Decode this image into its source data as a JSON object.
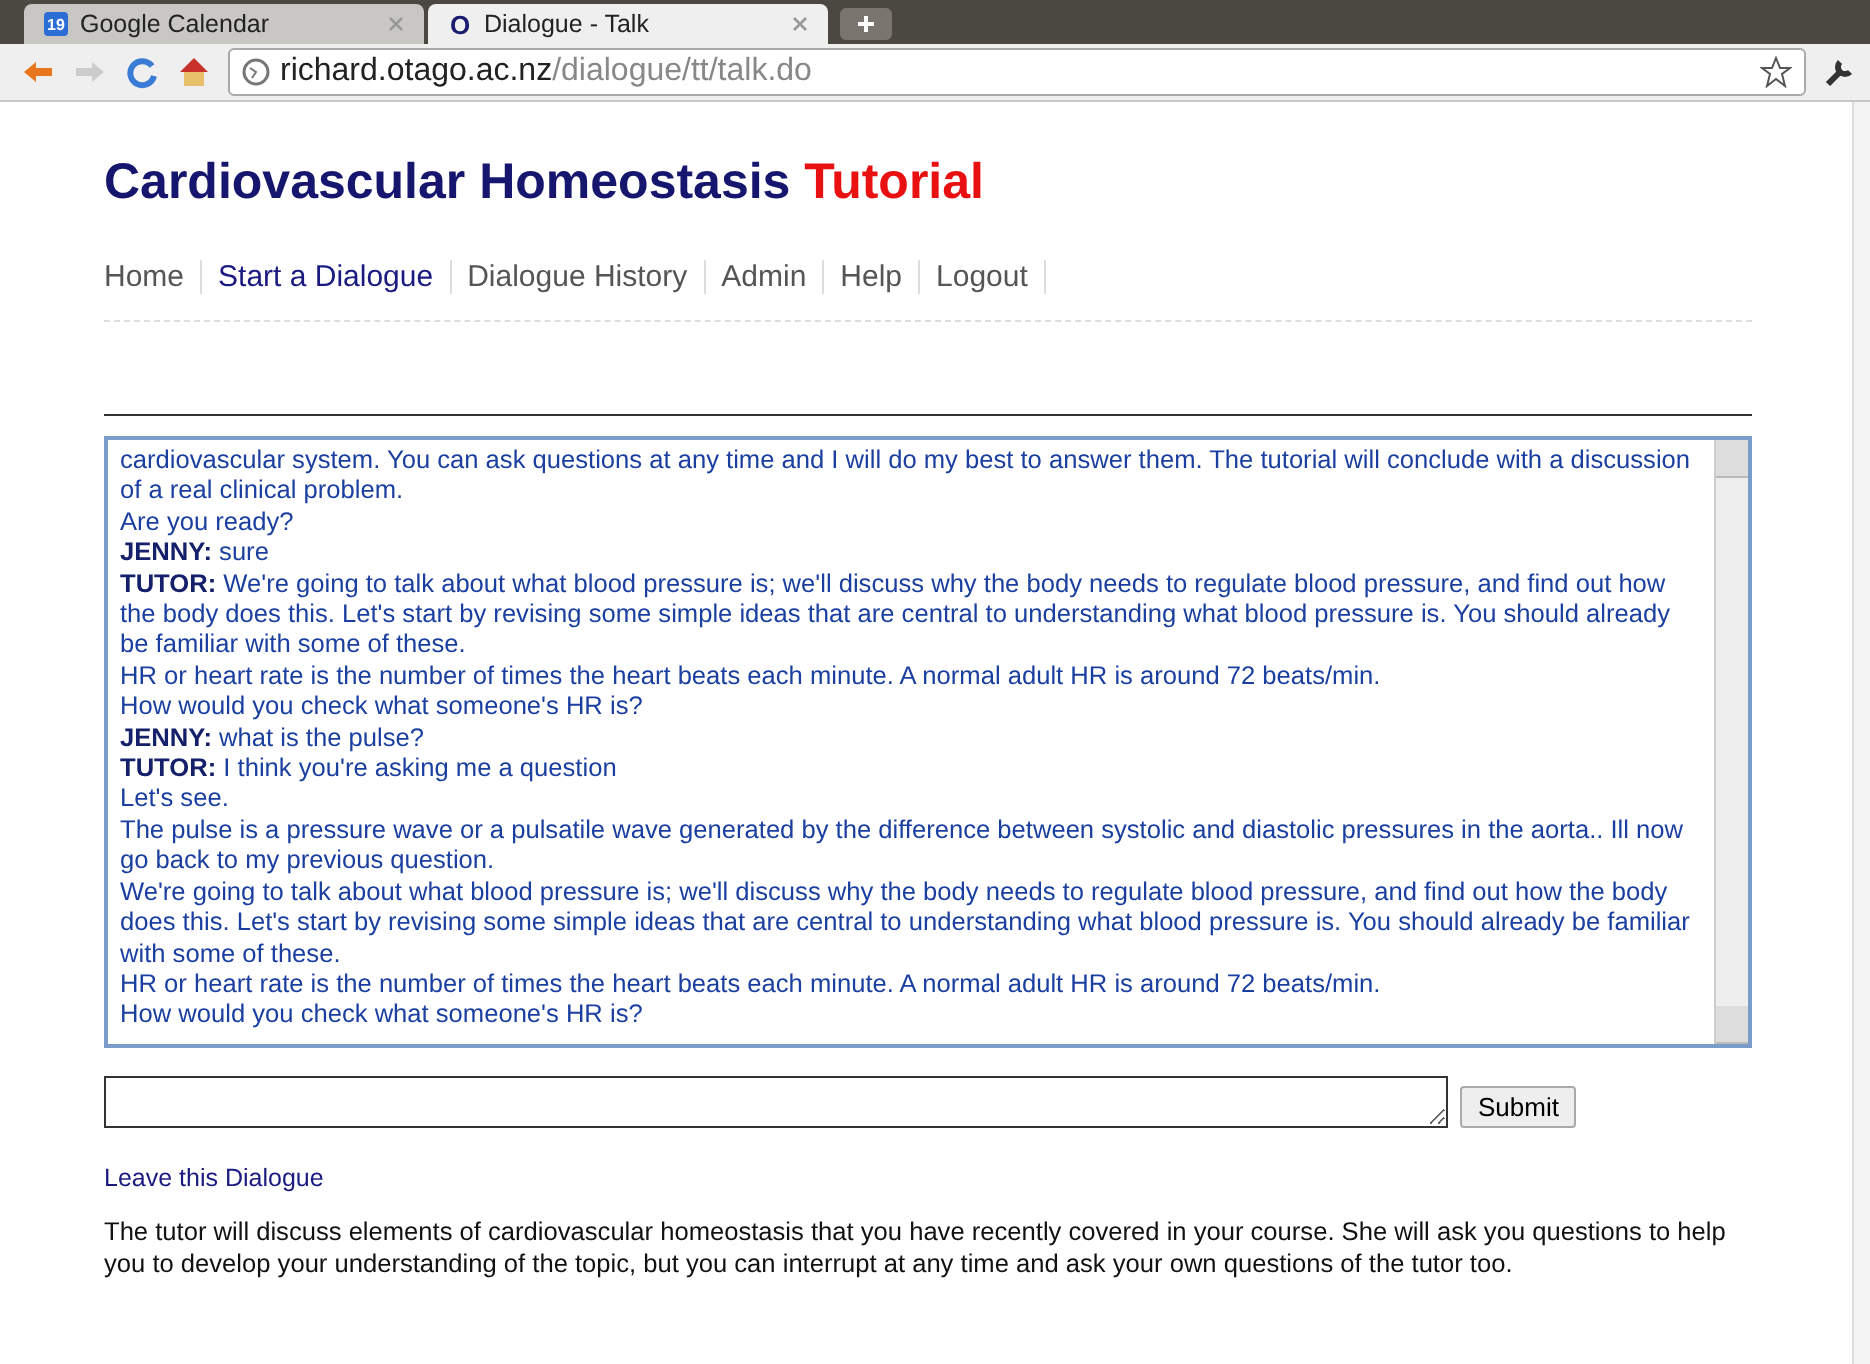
{
  "browser": {
    "tabs": [
      {
        "title": "Google Calendar",
        "favicon": "19",
        "selected": false
      },
      {
        "title": "Dialogue - Talk",
        "favicon": "O",
        "selected": true
      }
    ],
    "address": {
      "host": "richard.otago.ac.nz",
      "path": "/dialogue/tt/talk.do"
    }
  },
  "page": {
    "title": "Cardiovascular Homeostasis",
    "title_accent": "Tutorial",
    "nav": [
      {
        "label": "Home",
        "selected": false
      },
      {
        "label": "Start a Dialogue",
        "selected": true
      },
      {
        "label": "Dialogue History",
        "selected": false
      },
      {
        "label": "Admin",
        "selected": false
      },
      {
        "label": "Help",
        "selected": false
      },
      {
        "label": "Logout",
        "selected": false
      }
    ],
    "transcript": [
      {
        "text": "cardiovascular system. You can ask questions at any time and I will do my best to answer them. The tutorial will conclude with a discussion of a real clinical problem."
      },
      {
        "text": "Are you ready?"
      },
      {
        "speaker": "JENNY:",
        "text": "sure"
      },
      {
        "speaker": "TUTOR:",
        "text": "We're going to talk about what blood pressure is; we'll discuss why the body needs to regulate blood pressure, and find out how the body does this. Let's start by revising some simple ideas that are central to understanding what blood pressure is. You should already be familiar with some of these."
      },
      {
        "text": "HR or heart rate is the number of times the heart beats each minute. A normal adult HR is around 72 beats/min."
      },
      {
        "text": "How would you check what someone's HR is?"
      },
      {
        "speaker": "JENNY:",
        "text": "what is the pulse?"
      },
      {
        "speaker": "TUTOR:",
        "text": "I think you're asking me a question"
      },
      {
        "text": "Let's see."
      },
      {
        "text": "The pulse is a pressure wave or a pulsatile wave generated by the difference between systolic and diastolic pressures in the aorta.. Ill now go back to my previous question."
      },
      {
        "text": "We're going to talk about what blood pressure is; we'll discuss why the body needs to regulate blood pressure, and find out how the body does this. Let's start by revising some simple ideas that are central to understanding what blood pressure is. You should already be familiar with some of these."
      },
      {
        "text": "HR or heart rate is the number of times the heart beats each minute. A normal adult HR is around 72 beats/min."
      },
      {
        "text": "How would you check what someone's HR is?"
      }
    ],
    "submit": "Submit",
    "leave_link": "Leave this Dialogue",
    "description": "The tutor will discuss elements of cardiovascular homeostasis that you have recently covered in your course. She will ask you questions to help you to develop your understanding of the topic, but you can interrupt at any time and ask your own questions of the tutor too."
  }
}
